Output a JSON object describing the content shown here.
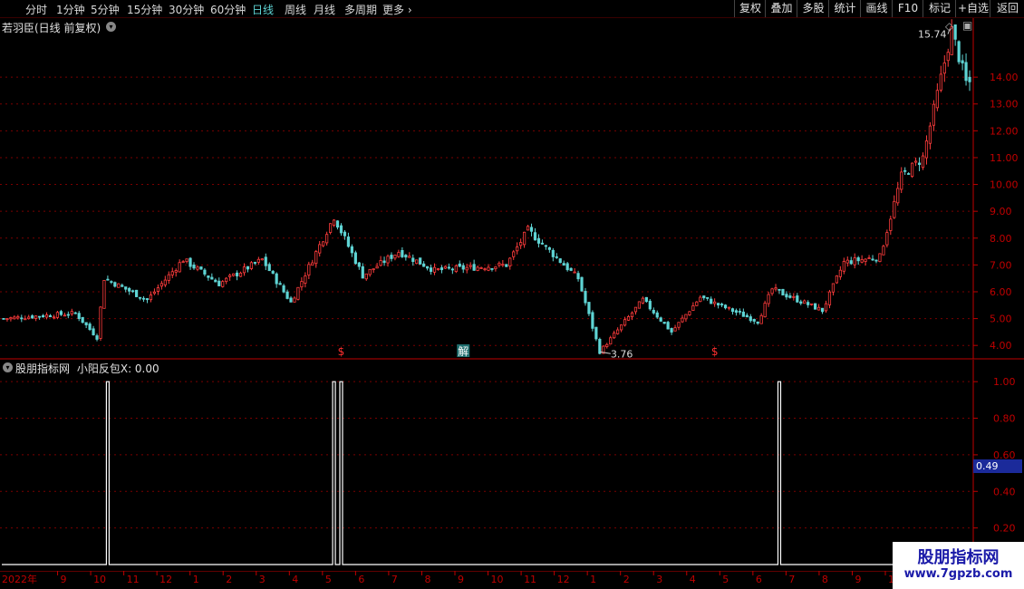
{
  "toolbar": {
    "periods": [
      "分时",
      "1分钟",
      "5分钟",
      "15分钟",
      "30分钟",
      "60分钟",
      "日线",
      "周线",
      "月线",
      "多周期",
      "更多"
    ],
    "active": "日线",
    "right_buttons": [
      "复权",
      "叠加",
      "多股",
      "统计",
      "画线",
      "F10",
      "标记",
      "+自选",
      "返回"
    ]
  },
  "main": {
    "title": "若羽臣(日线 前复权)",
    "y_ticks": [
      "14.00",
      "13.00",
      "12.00",
      "11.00",
      "10.00",
      "9.00",
      "8.00",
      "7.00",
      "6.00",
      "5.00",
      "4.00"
    ],
    "high_label": "15.74",
    "low_label": "3.76",
    "markers": [
      {
        "text": "$",
        "date_idx": 94,
        "color": "#ff3030"
      },
      {
        "text": "解",
        "date_idx": 128,
        "color": "#40c0c0"
      },
      {
        "text": "$",
        "date_idx": 198,
        "color": "#ff3030"
      }
    ]
  },
  "sub": {
    "title": "股朋指标网",
    "indicator": "小阳反包X: 0.00",
    "y_ticks": [
      "1.00",
      "0.80",
      "0.60",
      "0.40",
      "0.20"
    ],
    "current_value": "0.49"
  },
  "time_axis": [
    "2022年",
    "9",
    "10",
    "11",
    "12",
    "1",
    "2",
    "3",
    "4",
    "5",
    "6",
    "7",
    "8",
    "9",
    "10",
    "11",
    "12",
    "1",
    "2",
    "3",
    "4",
    "5",
    "6",
    "7",
    "8",
    "9",
    "10"
  ],
  "watermark": {
    "main": "股朋指标网",
    "url": "www.7gpzb.com"
  },
  "colors": {
    "up": "#ff3c3c",
    "down": "#5fd4d4",
    "grid": "#7a0000",
    "axis": "#c00000"
  },
  "chart_data": {
    "type": "candlestick",
    "title": "若羽臣(日线 前复权)",
    "ylim": [
      3.5,
      16.2
    ],
    "price_path": [
      [
        0,
        5.0
      ],
      [
        20,
        5.2
      ],
      [
        26,
        4.3
      ],
      [
        28,
        6.5
      ],
      [
        40,
        5.7
      ],
      [
        50,
        7.2
      ],
      [
        60,
        6.3
      ],
      [
        72,
        7.2
      ],
      [
        80,
        5.6
      ],
      [
        92,
        8.8
      ],
      [
        100,
        6.6
      ],
      [
        110,
        7.5
      ],
      [
        120,
        6.8
      ],
      [
        140,
        7.0
      ],
      [
        146,
        8.3
      ],
      [
        160,
        6.5
      ],
      [
        166,
        3.76
      ],
      [
        178,
        5.7
      ],
      [
        186,
        4.5
      ],
      [
        194,
        5.8
      ],
      [
        210,
        4.9
      ],
      [
        214,
        6.1
      ],
      [
        228,
        5.3
      ],
      [
        234,
        7.1
      ],
      [
        244,
        7.3
      ],
      [
        250,
        10.3
      ],
      [
        256,
        11.0
      ],
      [
        264,
        15.74
      ],
      [
        268,
        13.8
      ]
    ],
    "signals": [
      {
        "date_idx": 29,
        "value": 1.0
      },
      {
        "date_idx": 92,
        "value": 1.0
      },
      {
        "date_idx": 94,
        "value": 1.0
      },
      {
        "date_idx": 216,
        "value": 1.0
      }
    ],
    "sub_ylim": [
      0,
      1.1
    ]
  }
}
